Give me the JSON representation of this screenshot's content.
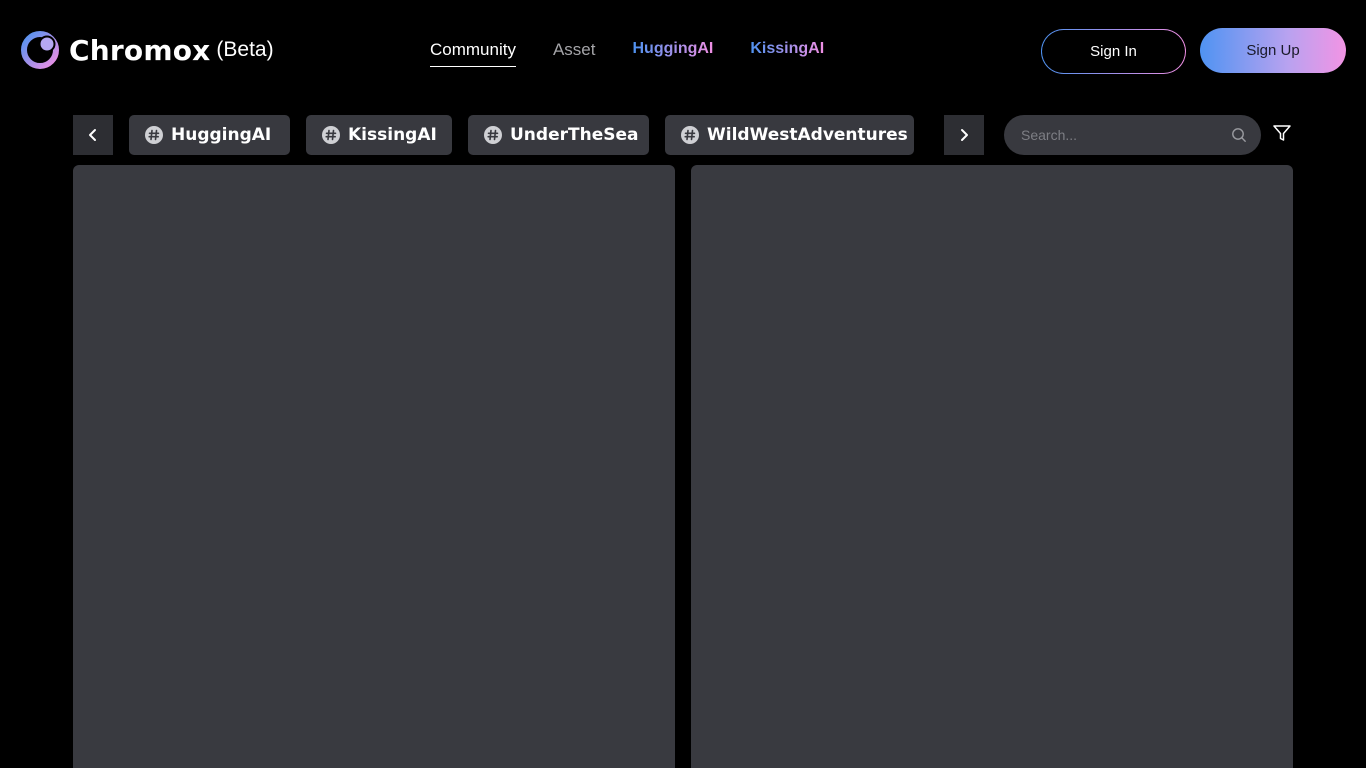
{
  "brand": {
    "name": "Chromox",
    "badge": "(Beta)",
    "accent_start": "#4e92f0",
    "accent_end": "#f08fe4"
  },
  "nav": {
    "items": [
      {
        "label": "Community",
        "active": true
      },
      {
        "label": "Asset",
        "active": false
      },
      {
        "label": "HuggingAI",
        "style": "gradient"
      },
      {
        "label": "KissingAI",
        "style": "gradient"
      }
    ]
  },
  "auth": {
    "sign_in": "Sign In",
    "sign_up": "Sign Up"
  },
  "tags": {
    "prev_icon": "chevron-left-icon",
    "next_icon": "chevron-right-icon",
    "items": [
      {
        "label": "HuggingAI",
        "icon": "hashtag-icon"
      },
      {
        "label": "KissingAI",
        "icon": "hashtag-icon"
      },
      {
        "label": "UnderTheSea",
        "icon": "hashtag-icon"
      },
      {
        "label": "WildWestAdventures",
        "icon": "hashtag-icon"
      }
    ]
  },
  "search": {
    "placeholder": "Search...",
    "value": "",
    "icon": "search-icon"
  },
  "filter": {
    "icon": "filter-icon"
  },
  "colors": {
    "background": "#000000",
    "surface": "#38393f",
    "card": "#393a40",
    "muted_text": "#a4a4a8"
  }
}
